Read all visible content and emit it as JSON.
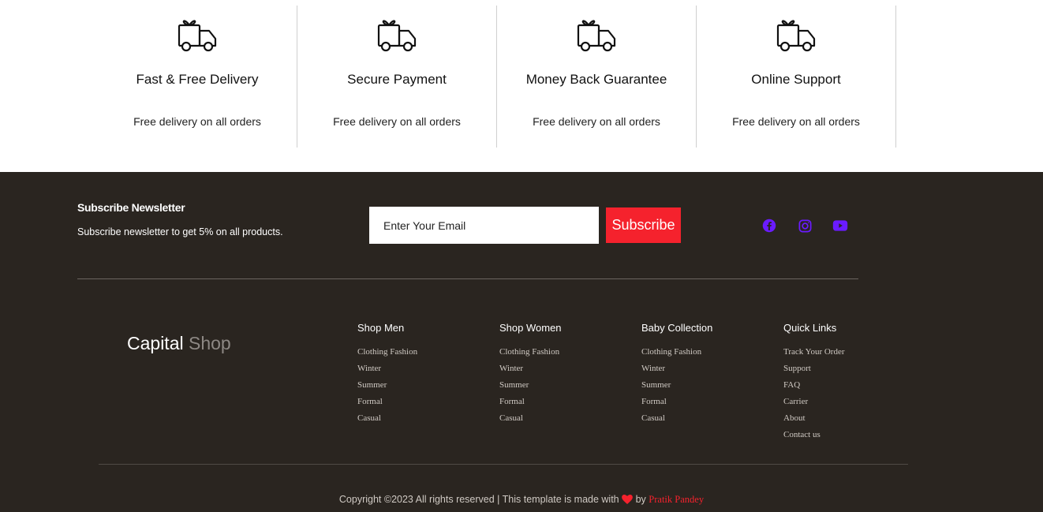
{
  "features": [
    {
      "icon": "delivery-truck-icon",
      "title": "Fast & Free Delivery",
      "desc": "Free delivery on all orders"
    },
    {
      "icon": "delivery-truck-icon",
      "title": "Secure Payment",
      "desc": "Free delivery on all orders"
    },
    {
      "icon": "delivery-truck-icon",
      "title": "Money Back Guarantee",
      "desc": "Free delivery on all orders"
    },
    {
      "icon": "delivery-truck-icon",
      "title": "Online Support",
      "desc": "Free delivery on all orders"
    }
  ],
  "newsletter": {
    "title": "Subscribe Newsletter",
    "desc": "Subscribe newsletter to get 5% on all products.",
    "placeholder": "Enter Your Email",
    "button": "Subscribe"
  },
  "social": {
    "color": "#6a1bff",
    "icons": [
      "facebook-icon",
      "instagram-icon",
      "youtube-icon"
    ]
  },
  "brand": {
    "name": "Capital",
    "accent": "Shop"
  },
  "columns": [
    {
      "title": "Shop Men",
      "links": [
        "Clothing Fashion",
        "Winter",
        "Summer",
        "Formal",
        "Casual"
      ]
    },
    {
      "title": "Shop Women",
      "links": [
        "Clothing Fashion",
        "Winter",
        "Summer",
        "Formal",
        "Casual"
      ]
    },
    {
      "title": "Baby Collection",
      "links": [
        "Clothing Fashion",
        "Winter",
        "Summer",
        "Formal",
        "Casual"
      ]
    },
    {
      "title": "Quick Links",
      "links": [
        "Track Your Order",
        "Support",
        "FAQ",
        "Carrier",
        "About",
        "Contact us"
      ]
    }
  ],
  "copyright": {
    "text": "Copyright ©2023 All rights reserved | This template is made with",
    "by": "by",
    "author": "Pratik Pandey"
  },
  "colors": {
    "footer_bg": "#2a2520",
    "accent": "#f5222d",
    "social": "#6a1bff"
  }
}
